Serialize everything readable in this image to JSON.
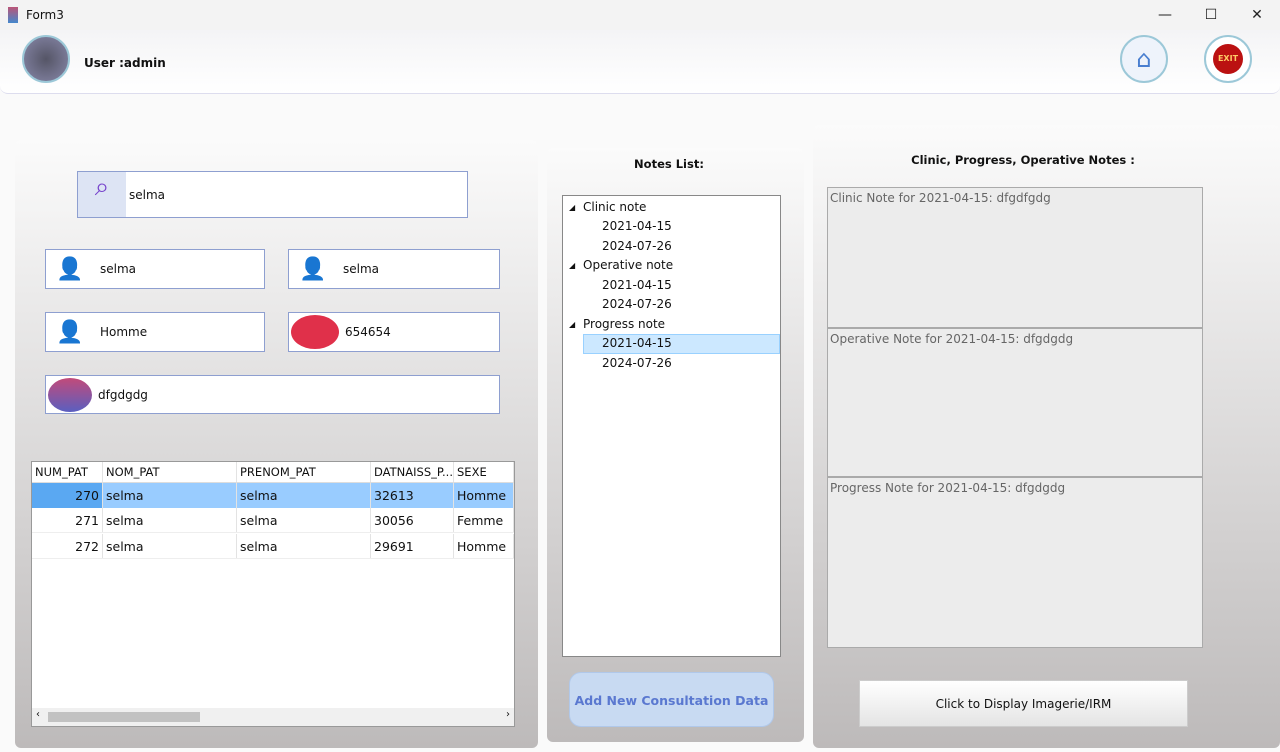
{
  "window": {
    "title": "Form3",
    "minimize": "—",
    "maximize": "☐",
    "close": "✕"
  },
  "header": {
    "user_label": "User :admin"
  },
  "patient": {
    "search": "selma",
    "nom": "selma",
    "prenom": "selma",
    "sexe": "Homme",
    "tel": "654654",
    "adresse": "dfgdgdg"
  },
  "table": {
    "columns": [
      "NUM_PAT",
      "NOM_PAT",
      "PRENOM_PAT",
      "DATNAISS_P...",
      "SEXE"
    ],
    "rows": [
      [
        "270",
        "selma",
        "selma",
        "32613",
        "Homme"
      ],
      [
        "271",
        "selma",
        "selma",
        "30056",
        "Femme"
      ],
      [
        "272",
        "selma",
        "selma",
        "29691",
        "Homme"
      ]
    ]
  },
  "notes_list": {
    "title": "Notes List:",
    "groups": [
      {
        "label": "Clinic note",
        "dates": [
          "2021-04-15",
          "2024-07-26"
        ]
      },
      {
        "label": "Operative note",
        "dates": [
          "2021-04-15",
          "2024-07-26"
        ]
      },
      {
        "label": "Progress note",
        "dates": [
          "2021-04-15",
          "2024-07-26"
        ]
      }
    ]
  },
  "add_button": "Add New Consultation Data",
  "notes": {
    "title": "Clinic, Progress,  Operative Notes :",
    "clinic": "Clinic Note for 2021-04-15: dfgdfgdg",
    "operative": "Operative Note for 2021-04-15: dfgdgdg",
    "progress": "Progress Note for 2021-04-15: dfgdgdg"
  },
  "display_button": "Click to Display Imagerie/IRM",
  "exit_label": "EXIT"
}
